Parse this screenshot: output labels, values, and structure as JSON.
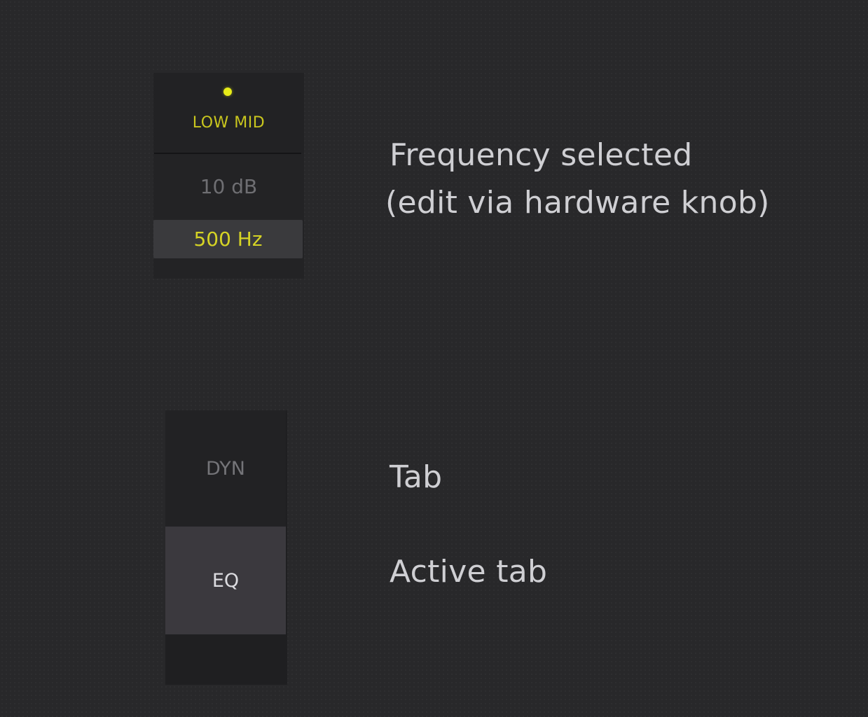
{
  "eq_band": {
    "name": "LOW MID",
    "gain": "10 dB",
    "frequency": "500 Hz",
    "led_color": "#e7ec18"
  },
  "tabs": [
    {
      "label": "DYN",
      "active": false
    },
    {
      "label": "EQ",
      "active": true
    }
  ],
  "annotations": {
    "frequency_line1": "Frequency selected",
    "frequency_line2": "(edit via hardware knob)",
    "tab": "Tab",
    "active_tab": "Active tab"
  },
  "colors": {
    "accent": "#d5d325",
    "background": "#28282a",
    "active_tab_bg": "#3b393e"
  }
}
